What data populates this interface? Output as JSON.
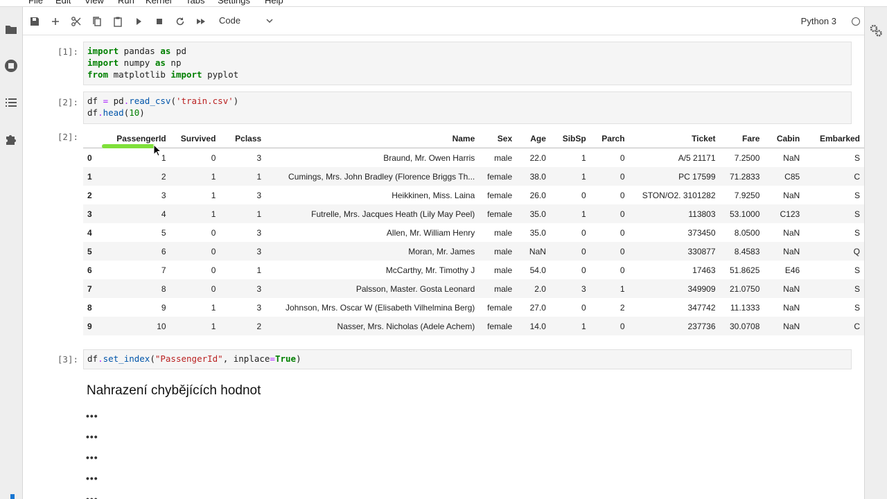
{
  "menu": [
    "File",
    "Edit",
    "View",
    "Run",
    "Kernel",
    "Tabs",
    "Settings",
    "Help"
  ],
  "toolbar": {
    "cell_type": "Code",
    "kernel": "Python 3"
  },
  "cells": [
    {
      "prompt": "[1]:",
      "lines": [
        "import pandas as pd",
        "import numpy as np",
        "from matplotlib import pyplot"
      ]
    },
    {
      "prompt": "[2]:",
      "lines": [
        "df = pd.read_csv('train.csv')",
        "df.head(10)"
      ]
    },
    {
      "prompt": "[2]:"
    },
    {
      "prompt": "[3]:",
      "lines": [
        "df.set_index(\"PassengerId\", inplace=True)"
      ]
    }
  ],
  "table": {
    "columns": [
      "",
      "PassengerId",
      "Survived",
      "Pclass",
      "Name",
      "Sex",
      "Age",
      "SibSp",
      "Parch",
      "Ticket",
      "Fare",
      "Cabin",
      "Embarked"
    ],
    "rows": [
      [
        "0",
        "1",
        "0",
        "3",
        "Braund, Mr. Owen Harris",
        "male",
        "22.0",
        "1",
        "0",
        "A/5 21171",
        "7.2500",
        "NaN",
        "S"
      ],
      [
        "1",
        "2",
        "1",
        "1",
        "Cumings, Mrs. John Bradley (Florence Briggs Th...",
        "female",
        "38.0",
        "1",
        "0",
        "PC 17599",
        "71.2833",
        "C85",
        "C"
      ],
      [
        "2",
        "3",
        "1",
        "3",
        "Heikkinen, Miss. Laina",
        "female",
        "26.0",
        "0",
        "0",
        "STON/O2. 3101282",
        "7.9250",
        "NaN",
        "S"
      ],
      [
        "3",
        "4",
        "1",
        "1",
        "Futrelle, Mrs. Jacques Heath (Lily May Peel)",
        "female",
        "35.0",
        "1",
        "0",
        "113803",
        "53.1000",
        "C123",
        "S"
      ],
      [
        "4",
        "5",
        "0",
        "3",
        "Allen, Mr. William Henry",
        "male",
        "35.0",
        "0",
        "0",
        "373450",
        "8.0500",
        "NaN",
        "S"
      ],
      [
        "5",
        "6",
        "0",
        "3",
        "Moran, Mr. James",
        "male",
        "NaN",
        "0",
        "0",
        "330877",
        "8.4583",
        "NaN",
        "Q"
      ],
      [
        "6",
        "7",
        "0",
        "1",
        "McCarthy, Mr. Timothy J",
        "male",
        "54.0",
        "0",
        "0",
        "17463",
        "51.8625",
        "E46",
        "S"
      ],
      [
        "7",
        "8",
        "0",
        "3",
        "Palsson, Master. Gosta Leonard",
        "male",
        "2.0",
        "3",
        "1",
        "349909",
        "21.0750",
        "NaN",
        "S"
      ],
      [
        "8",
        "9",
        "1",
        "3",
        "Johnson, Mrs. Oscar W (Elisabeth Vilhelmina Berg)",
        "female",
        "27.0",
        "0",
        "2",
        "347742",
        "11.1333",
        "NaN",
        "S"
      ],
      [
        "9",
        "10",
        "1",
        "2",
        "Nasser, Mrs. Nicholas (Adele Achem)",
        "female",
        "14.0",
        "1",
        "0",
        "237736",
        "30.0708",
        "NaN",
        "C"
      ]
    ]
  },
  "markdown": {
    "heading": "Nahrazení chybějících hodnot",
    "collapsed": "•••"
  }
}
